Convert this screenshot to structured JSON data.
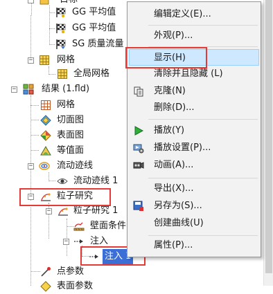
{
  "tree": {
    "items": [
      {
        "label": "目标"
      },
      {
        "label": "GG 平均值"
      },
      {
        "label": "GG 平均值"
      },
      {
        "label": "SG 质量流量"
      },
      {
        "label": "网格"
      },
      {
        "label": "全局网格"
      },
      {
        "label": "结果 (1.fld)"
      },
      {
        "label": "网格"
      },
      {
        "label": "切面图"
      },
      {
        "label": "表面图"
      },
      {
        "label": "等值面"
      },
      {
        "label": "流动迹线"
      },
      {
        "label": "流动迹线 1"
      },
      {
        "label": "粒子研究"
      },
      {
        "label": "粒子研究 1"
      },
      {
        "label": "壁面条件"
      },
      {
        "label": "注入"
      },
      {
        "label": "注入 1"
      },
      {
        "label": "点参数"
      },
      {
        "label": "表面参数"
      }
    ]
  },
  "menu": {
    "items": [
      {
        "label": "编辑定义(E)...",
        "icon": ""
      },
      {
        "label": "外观(P)...",
        "icon": ""
      },
      {
        "label": "显示(H)",
        "icon": ""
      },
      {
        "label": "清除并且隐藏 (L)",
        "icon": ""
      },
      {
        "label": "克隆(N)",
        "icon": "clone-icon"
      },
      {
        "label": "删除(D)...",
        "icon": ""
      },
      {
        "label": "播放(Y)",
        "icon": "play-icon"
      },
      {
        "label": "播放设置(P)...",
        "icon": "play-settings-icon"
      },
      {
        "label": "动画(A)...",
        "icon": "animation-icon"
      },
      {
        "label": "导出(X)...",
        "icon": ""
      },
      {
        "label": "另存为(S)...",
        "icon": "save-as-icon"
      },
      {
        "label": "创建曲线(U)",
        "icon": ""
      },
      {
        "label": "属性(P)...",
        "icon": ""
      }
    ]
  },
  "colors": {
    "highlight": "#cde8ff",
    "selection": "#3b6fd6",
    "annotation": "#e53935"
  }
}
